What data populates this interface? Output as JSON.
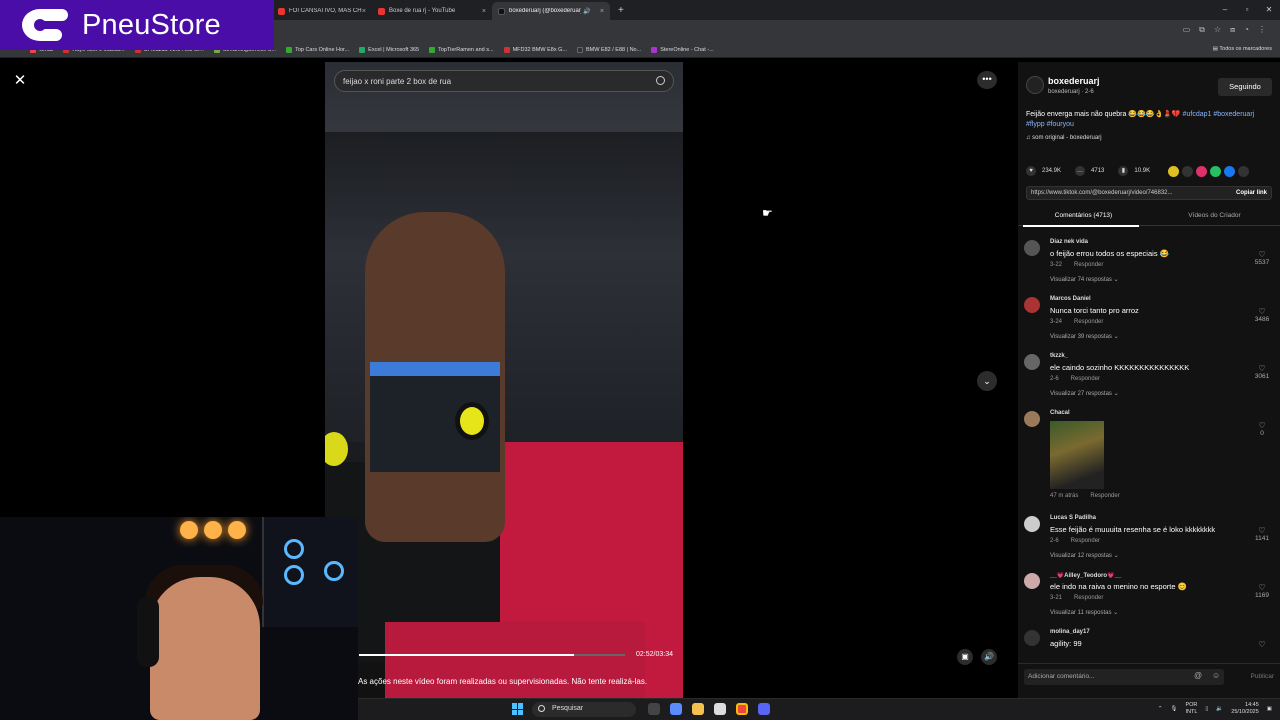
{
  "browser": {
    "tabs": [
      {
        "label": "FOI CANSATIVO, MAS CHEGAM...",
        "color": "#e33"
      },
      {
        "label": "Boxe de rua rj - YouTube",
        "color": "#e33"
      },
      {
        "label": "boxederuarj (@boxederuarj)",
        "color": "#111"
      }
    ],
    "bookmarks": [
      {
        "label": "Gmail",
        "color": "#e44"
      },
      {
        "label": "Rayo-c3cF9 Mazda...",
        "color": "#c33"
      },
      {
        "label": "Cr Mazda V2.5 / Lui Gi...",
        "color": "#c33"
      },
      {
        "label": "StreamingService S...",
        "color": "#7a4"
      },
      {
        "label": "Top Cars Online Hor...",
        "color": "#3a3"
      },
      {
        "label": "Excel | Microsoft 365",
        "color": "#2a6"
      },
      {
        "label": "TopTierRamen and s...",
        "color": "#3a3"
      },
      {
        "label": "MFD32 BMW E8x G...",
        "color": "#c33"
      },
      {
        "label": "BMW E82 / E88 | No...",
        "color": "#333"
      },
      {
        "label": "StereOnline - Chat -...",
        "color": "#a3c"
      }
    ],
    "bookmarks_right": "Todos os marcadores"
  },
  "logo": {
    "text": "PneuStore",
    "color": "#4a0da8"
  },
  "video": {
    "search_text": "feijao x roni parte 2 box de rua",
    "timecode": "02:52/03:34",
    "progress": 0.81,
    "disclaimer": "As ações neste vídeo foram realizadas ou supervisionadas. Não tente realizá-las."
  },
  "panel": {
    "author": "boxederuarj",
    "author_sub": "boxederuarj · 2-6",
    "follow": "Seguindo",
    "caption_text": "Feijão enverga mais não quebra 😂😂😂👌💄💔",
    "caption_tags": "#ufcdap1 #boxederuarj #flypp #fouryou",
    "music": "♫ som original - boxederuarj",
    "likes": "234.9K",
    "comments": "4713",
    "saves": "10.9K",
    "url": "https://www.tiktok.com/@boxederuarj/video/746832...",
    "copy": "Copiar link",
    "tab_comments": "Comentários (4713)",
    "tab_videos": "Vídeos do Criador",
    "comment_list": [
      {
        "user": "Diaz nek vida",
        "text": "o feijão errou todos os especiais 😂",
        "date": "3-22",
        "reply": "Responder",
        "view": "Visualizar 74 respostas ⌄",
        "likes": "5537",
        "color": "#555"
      },
      {
        "user": "Marcos Daniel",
        "text": "Nunca torci tanto pro arroz",
        "date": "3-24",
        "reply": "Responder",
        "view": "Visualizar 39 respostas ⌄",
        "likes": "3486",
        "color": "#a33"
      },
      {
        "user": "tkzzk_",
        "text": "ele caindo sozinho KKKKKKKKKKKKKKK",
        "date": "2-6",
        "reply": "Responder",
        "view": "Visualizar 27 respostas ⌄",
        "likes": "3061",
        "color": "#666"
      },
      {
        "user": "Chacal",
        "text": "",
        "date": "47 m atrás",
        "reply": "Responder",
        "view": "",
        "likes": "0",
        "color": "#9a7a5a"
      },
      {
        "user": "Lucas S Padilha",
        "text": "Esse feijão é muuuita resenha se é loko kkkkkkkk",
        "date": "2-6",
        "reply": "Responder",
        "view": "Visualizar 12 respostas ⌄",
        "likes": "1141",
        "color": "#ccc"
      },
      {
        "user": "__💗Ailley_Teodoro💗__",
        "text": "ele indo na raiva o menino no esporte 😊",
        "date": "3-21",
        "reply": "Responder",
        "view": "Visualizar 11 respostas ⌄",
        "likes": "1169",
        "color": "#caa"
      },
      {
        "user": "molina_day17",
        "text": "agility: 99",
        "date": "",
        "reply": "",
        "view": "",
        "likes": "",
        "color": "#333"
      }
    ],
    "compose_placeholder": "Adicionar comentário...",
    "publish": "Publicar"
  },
  "taskbar": {
    "search": "Pesquisar",
    "lang1": "POR",
    "lang2": "INTL",
    "time": "14:45",
    "date": "25/10/2025"
  }
}
